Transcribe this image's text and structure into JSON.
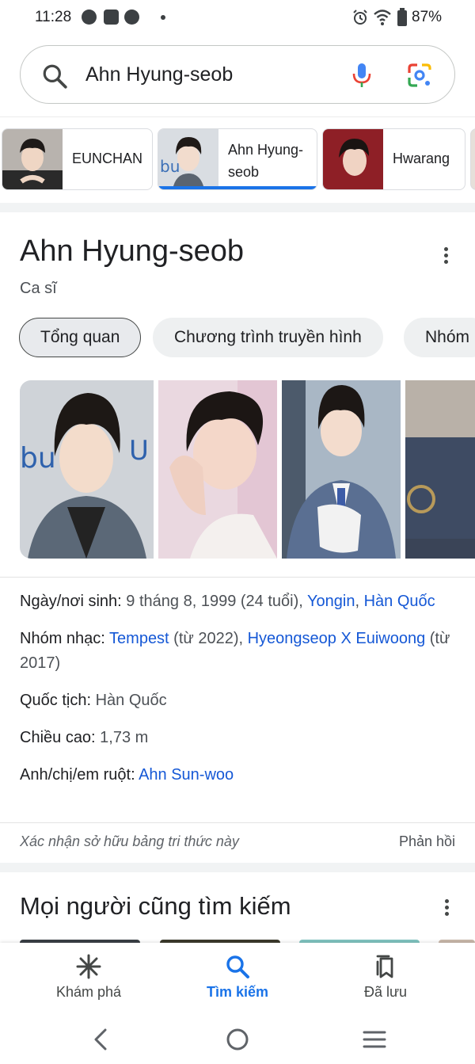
{
  "status_bar": {
    "time": "11:28",
    "battery": "87%",
    "icons": [
      "messenger-icon",
      "zalo-icon",
      "compass-app-icon",
      "alarm-icon",
      "wifi-icon",
      "battery-icon"
    ]
  },
  "search": {
    "query": "Ahn Hyung-seob",
    "icons": [
      "search-icon",
      "mic-icon",
      "google-lens-icon"
    ]
  },
  "entity_chips": [
    {
      "label": "EUNCHAN",
      "selected": false
    },
    {
      "label": "Ahn Hyung-\nseob",
      "selected": true
    },
    {
      "label": "Hwarang",
      "selected": false
    }
  ],
  "knowledge_panel": {
    "title": "Ahn Hyung-seob",
    "subtitle": "Ca sĩ",
    "tabs": [
      {
        "label": "Tổng quan",
        "active": true
      },
      {
        "label": "Chương trình truyền hình",
        "active": false
      },
      {
        "label": "Nhóm",
        "active": false
      }
    ],
    "facts": {
      "birth": {
        "key": "Ngày/nơi sinh: ",
        "value": "9 tháng 8, 1999 (24 tuổi), ",
        "link1": "Yongin",
        "sep": ", ",
        "link2": "Hàn Quốc"
      },
      "group": {
        "key": "Nhóm nhạc: ",
        "link1": "Tempest",
        "value1": " (từ 2022), ",
        "link2": "Hyeongseop X Euiwoong",
        "value2": " (từ 2017)"
      },
      "nationality": {
        "key": "Quốc tịch: ",
        "value": "Hàn Quốc"
      },
      "height": {
        "key": "Chiều cao: ",
        "value": "1,73 m"
      },
      "siblings": {
        "key": "Anh/chị/em ruột: ",
        "link": "Ahn Sun-woo"
      }
    },
    "claim": "Xác nhận sở hữu bảng tri thức này",
    "feedback": "Phản hồi"
  },
  "people_also_search": {
    "title": "Mọi người cũng tìm kiếm"
  },
  "bottom_nav": [
    {
      "label": "Khám phá",
      "icon": "discover-icon",
      "active": false
    },
    {
      "label": "Tìm kiếm",
      "icon": "search-icon",
      "active": true
    },
    {
      "label": "Đã lưu",
      "icon": "saved-icon",
      "active": false
    }
  ],
  "colors": {
    "accent": "#1a73e8",
    "link": "#1558d6",
    "text": "#202124",
    "secondary_text": "#4d5156"
  }
}
